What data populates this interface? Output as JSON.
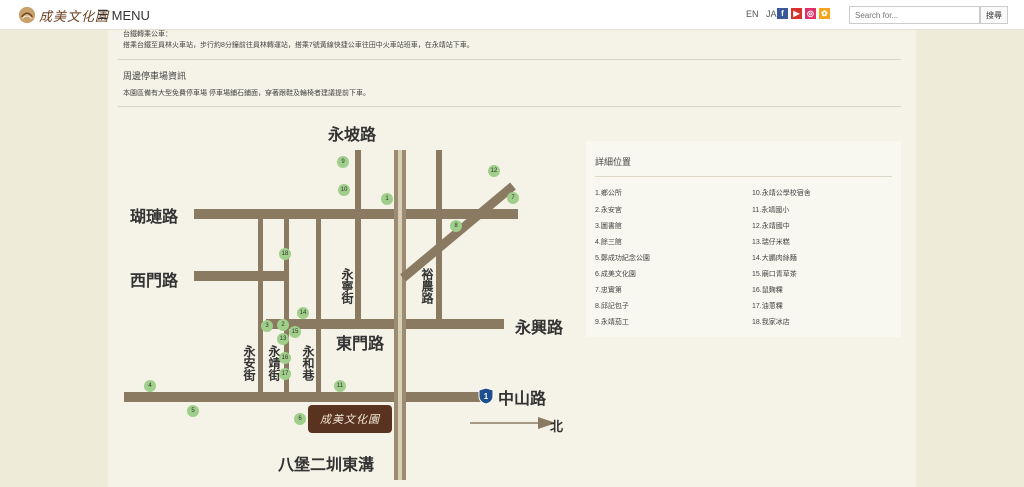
{
  "header": {
    "logo_text": "成美文化園",
    "menu_label": "MENU",
    "lang_en": "EN",
    "lang_ja": "JA",
    "social_icons": [
      "facebook-icon",
      "youtube-icon",
      "instagram-icon",
      "flickr-icon"
    ],
    "search_placeholder": "Search for...",
    "search_button": "搜尋"
  },
  "content": {
    "bus_heading_partial": "台鐵轉乘公車：",
    "bus_text": "搭乘台鐵至員林火車站，步行約8分鐘前往員林轉運站，搭乘7號黃線快捷公車往田中火車站班車，在永靖站下車。",
    "parking_title": "周邊停車場資訊",
    "parking_text": "本園區備有大型免費停車場 停車場鋪石鋪面，穿著跟鞋及輪椅者建議提前下車。"
  },
  "map": {
    "roads": {
      "yongpo": "永坡路",
      "hulian": "瑚璉路",
      "ximen": "西門路",
      "yongxing": "永興路",
      "dongmen": "東門路",
      "zhongshan": "中山路",
      "bapao": "八堡二圳東溝",
      "yongning": "永寧街",
      "yunong": "裕農路",
      "yongan": "永安街",
      "yongjing": "永靖街",
      "yonghe": "永和巷"
    },
    "north_label": "北",
    "brand_label": "成美文化園",
    "route_badge": "1",
    "pins": [
      "1",
      "2",
      "3",
      "4",
      "5",
      "6",
      "7",
      "8",
      "9",
      "10",
      "11",
      "12",
      "13",
      "14",
      "15",
      "16",
      "17",
      "18"
    ]
  },
  "locations": {
    "title": "詳細位置",
    "left": [
      "1.鄉公所",
      "2.永安宮",
      "3.圖書館",
      "4.餘三館",
      "5.鄭成功紀念公園",
      "6.成美文化園",
      "7.忠實第",
      "8.邱記包子",
      "9.永靖茄工"
    ],
    "right": [
      "10.永靖公學校宿舍",
      "11.永靖國小",
      "12.永靖國中",
      "13.瑞仔米糕",
      "14.大鵬肉絲麵",
      "15.廟口青草茶",
      "16.鼠麴粿",
      "17.油蔥粿",
      "18.我家冰店"
    ]
  }
}
